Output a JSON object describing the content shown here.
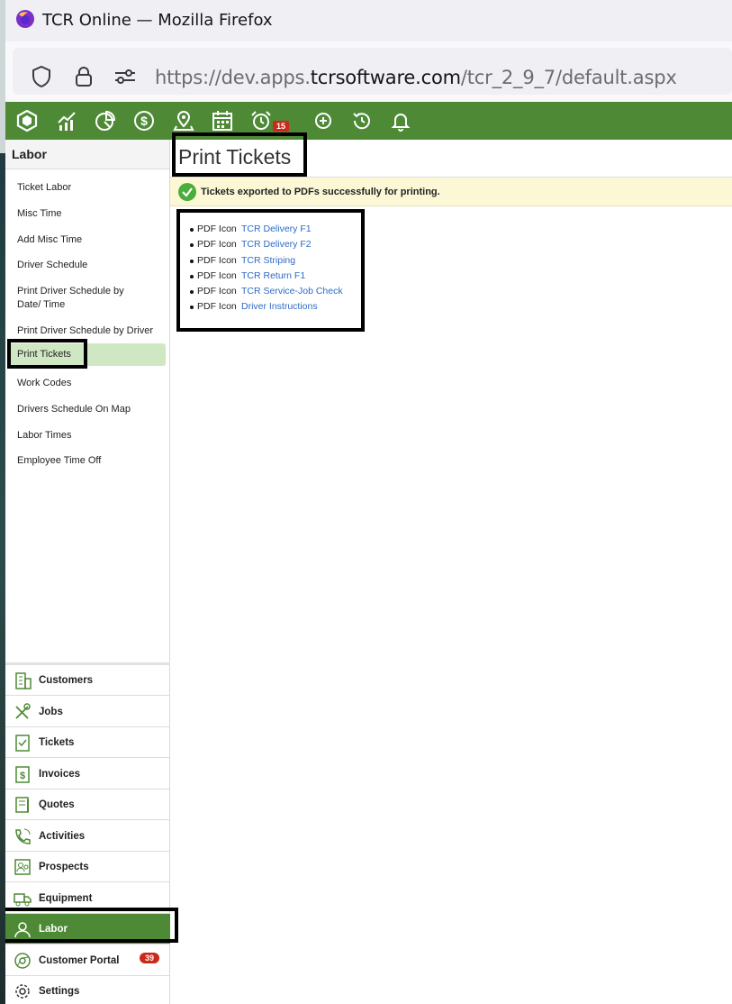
{
  "browser": {
    "window_title": "TCR Online — Mozilla Firefox",
    "url_prefix": "https://dev.apps.",
    "url_domain": "tcrsoftware.com",
    "url_path": "/tcr_2_9_7/default.aspx"
  },
  "appbar": {
    "icons": [
      "app-logo-icon",
      "chart-icon",
      "pie-icon",
      "dollar-icon",
      "map-pin-icon",
      "calendar-icon",
      "alarm-icon",
      "plus-circle-icon",
      "history-icon",
      "bell-icon"
    ],
    "alarm_badge": "15",
    "accent": "#4e8a36"
  },
  "sidebar": {
    "header": "Labor",
    "items": [
      {
        "label": "Ticket Labor"
      },
      {
        "label": "Misc Time"
      },
      {
        "label": "Add Misc Time"
      },
      {
        "label": "Driver Schedule"
      },
      {
        "label": "Print Driver Schedule by Date/ Time"
      },
      {
        "label": "Print Driver Schedule by Driver"
      },
      {
        "label": "Print Tickets"
      },
      {
        "label": "Work Codes"
      },
      {
        "label": "Drivers Schedule On Map"
      },
      {
        "label": "Labor Times"
      },
      {
        "label": "Employee Time Off"
      }
    ],
    "active_item": "Print Tickets"
  },
  "modules": [
    {
      "label": "Customers",
      "icon": "building-icon"
    },
    {
      "label": "Jobs",
      "icon": "tools-icon"
    },
    {
      "label": "Tickets",
      "icon": "ticket-icon"
    },
    {
      "label": "Invoices",
      "icon": "invoice-icon"
    },
    {
      "label": "Quotes",
      "icon": "quote-icon"
    },
    {
      "label": "Activities",
      "icon": "phone-icon"
    },
    {
      "label": "Prospects",
      "icon": "prospects-icon"
    },
    {
      "label": "Equipment",
      "icon": "truck-icon"
    },
    {
      "label": "Labor",
      "icon": "person-icon"
    },
    {
      "label": "Customer Portal",
      "icon": "chrome-icon",
      "badge": "39"
    },
    {
      "label": "Settings",
      "icon": "gear-icon"
    }
  ],
  "main": {
    "title": "Print Tickets",
    "alert": "Tickets exported to PDFs successfully for printing.",
    "pdf_icon_alt": "PDF Icon",
    "files": [
      "TCR Delivery F1",
      "TCR Delivery F2",
      "TCR Striping",
      "TCR Return F1",
      "TCR Service-Job Check",
      "Driver Instructions"
    ]
  }
}
